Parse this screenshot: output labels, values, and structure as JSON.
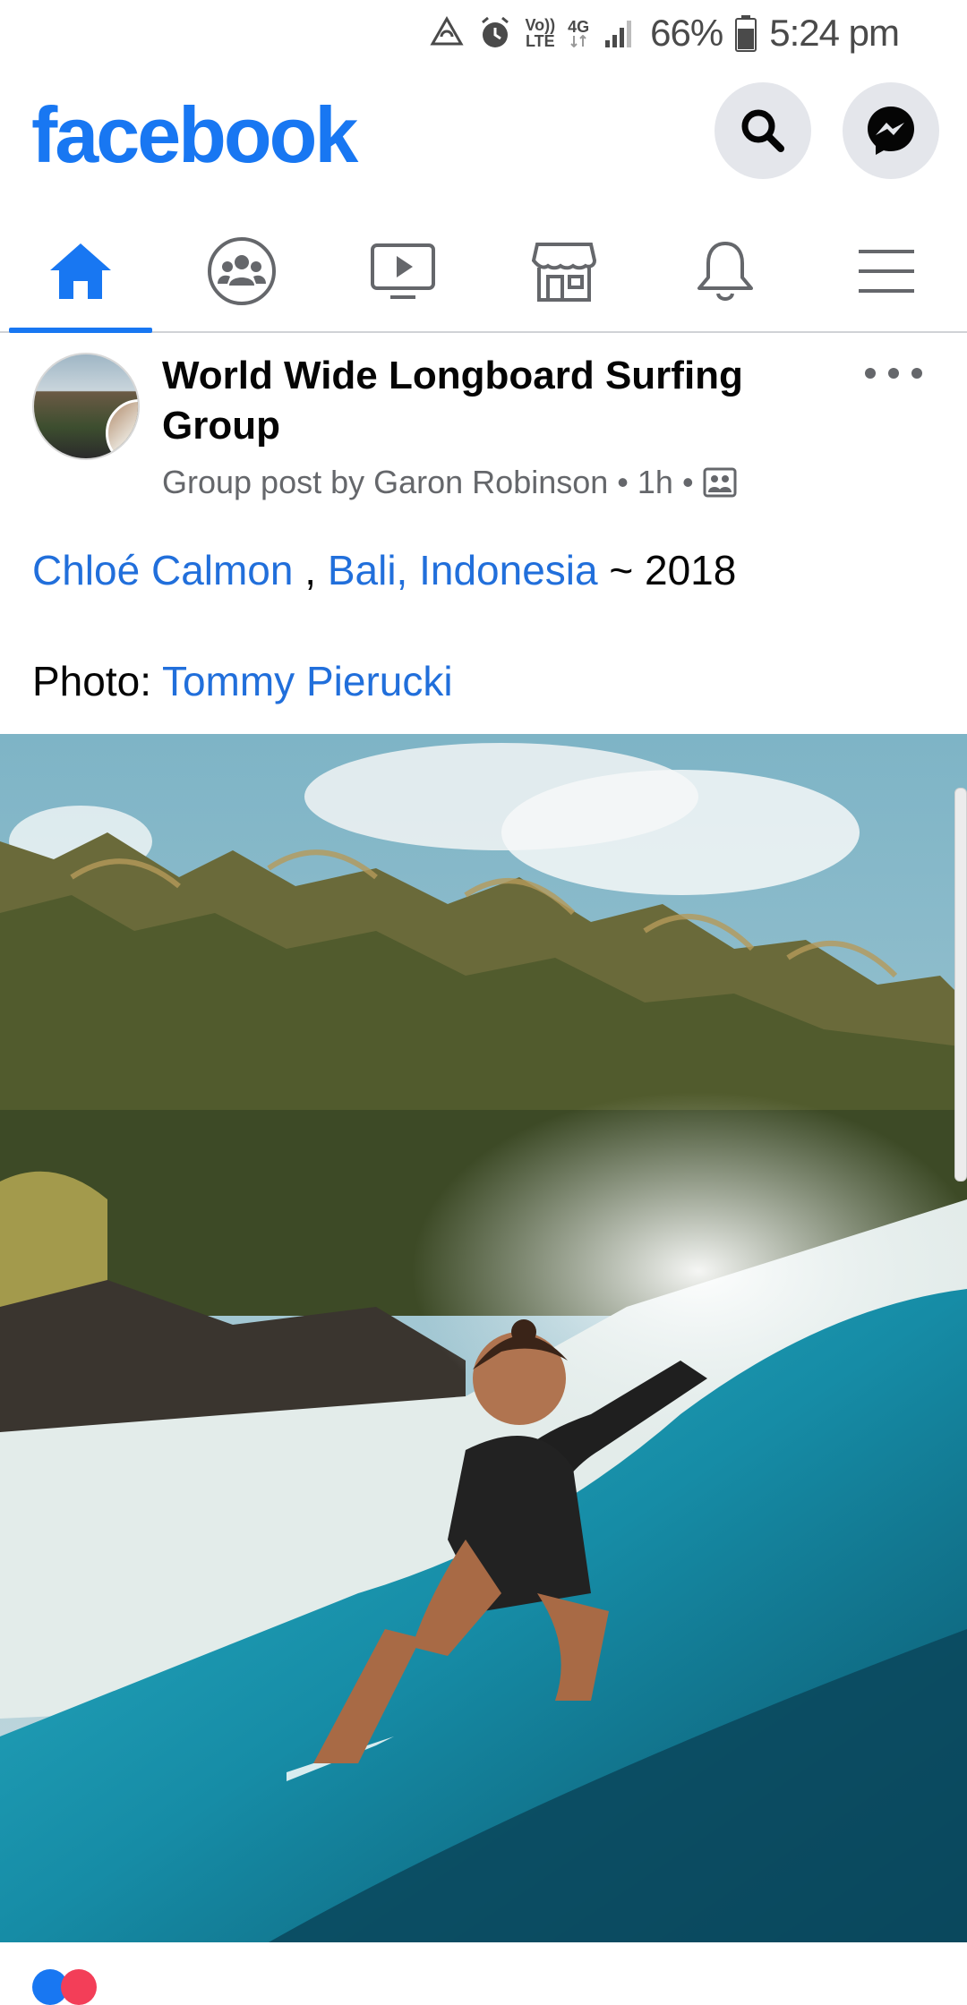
{
  "status_bar": {
    "volte_top": "Vo))",
    "volte_bottom": "LTE",
    "network": "4G",
    "battery": "66%",
    "time": "5:24 pm"
  },
  "header": {
    "logo": "facebook"
  },
  "nav": {
    "tabs": [
      {
        "name": "home",
        "active": true
      },
      {
        "name": "groups",
        "active": false
      },
      {
        "name": "watch",
        "active": false
      },
      {
        "name": "marketplace",
        "active": false
      },
      {
        "name": "notifications",
        "active": false
      },
      {
        "name": "menu",
        "active": false
      }
    ]
  },
  "post": {
    "group_name": "World Wide Longboard Surfing Group",
    "meta_prefix": "Group post by Garon Robinson",
    "meta_time": "1h",
    "separator": "•",
    "text": {
      "person_link": "Chloé Calmon",
      "comma": " , ",
      "location_link": "Bali, Indonesia",
      "year_suffix": " ~ 2018",
      "photo_label": "Photo: ",
      "photographer_link": "Tommy Pierucki"
    }
  },
  "colors": {
    "brand": "#1877f2",
    "link": "#216fdb",
    "secondary_text": "#65676b"
  }
}
